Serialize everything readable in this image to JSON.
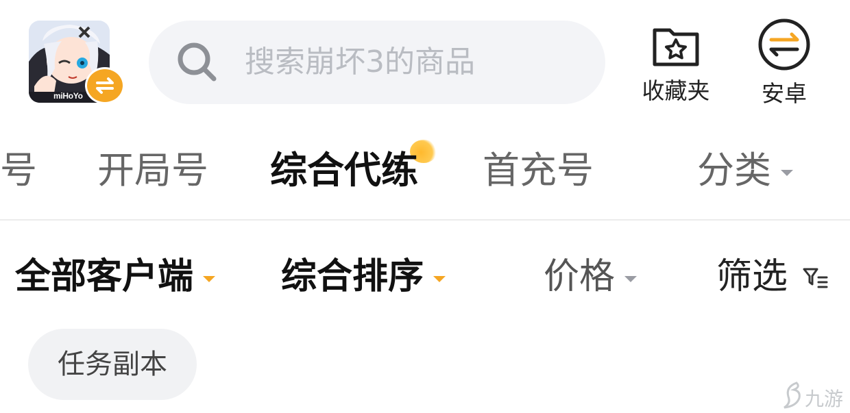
{
  "header": {
    "game_icon": {
      "icon": "game-avatar-icon",
      "publisher": "miHoYo"
    },
    "switch_badge_icon": "swap-arrows-icon",
    "search": {
      "placeholder": "搜索崩坏3的商品",
      "icon": "search-icon"
    },
    "favorites": {
      "label": "收藏夹",
      "icon": "star-folder-icon"
    },
    "platform": {
      "label": "安卓",
      "icon": "swap-arrows-icon"
    }
  },
  "tabs": [
    {
      "label": "号"
    },
    {
      "label": "开局号"
    },
    {
      "label": "综合代练",
      "active": true
    },
    {
      "label": "首充号"
    },
    {
      "label": "分类"
    }
  ],
  "filters": [
    {
      "label": "全部客户端"
    },
    {
      "label": "综合排序"
    },
    {
      "label": "价格"
    },
    {
      "label": "筛选",
      "icon": "filter-icon"
    }
  ],
  "chips": [
    {
      "label": "任务副本"
    }
  ],
  "watermark": {
    "text": "九游"
  },
  "colors": {
    "accent": "#f5a623",
    "search_bg": "#f3f4f7",
    "chip_bg": "#f1f2f4"
  }
}
